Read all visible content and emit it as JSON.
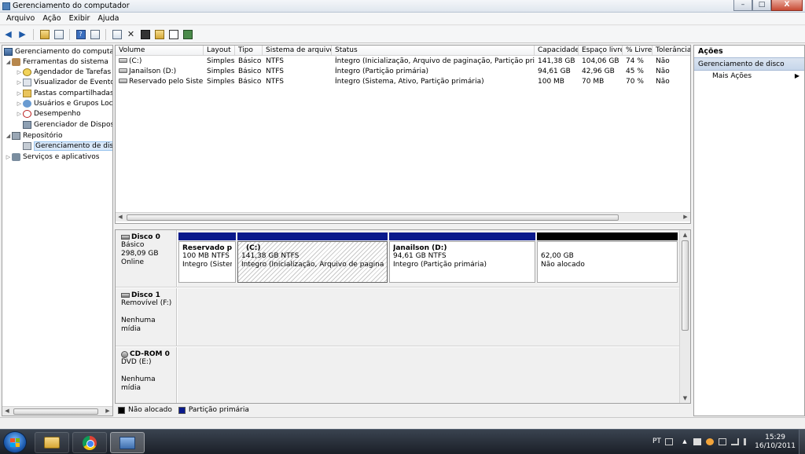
{
  "window": {
    "title": "Gerenciamento do computador",
    "buttons": {
      "minimize": "–",
      "maximize": "□",
      "close": "X"
    }
  },
  "menu": {
    "items": [
      "Arquivo",
      "Ação",
      "Exibir",
      "Ajuda"
    ]
  },
  "toolbar": {
    "icons": [
      "back-arrow-icon",
      "forward-arrow-icon",
      "up-folder-icon",
      "show-tree-icon",
      "help-icon",
      "properties-icon",
      "refresh-icon",
      "delete-icon",
      "properties-sheet-icon",
      "open-icon",
      "search-icon",
      "settings-icon"
    ]
  },
  "tree": {
    "items": [
      {
        "label": "Gerenciamento do computador",
        "icon": "computer-icon"
      },
      {
        "label": "Ferramentas do sistema",
        "icon": "tools-icon"
      },
      {
        "label": "Agendador de Tarefas",
        "icon": "clock-icon"
      },
      {
        "label": "Visualizador de Eventos",
        "icon": "event-log-icon"
      },
      {
        "label": "Pastas compartilhadas",
        "icon": "folder-icon"
      },
      {
        "label": "Usuários e Grupos Loca",
        "icon": "users-icon"
      },
      {
        "label": "Desempenho",
        "icon": "performance-icon"
      },
      {
        "label": "Gerenciador de Disposit",
        "icon": "device-icon"
      },
      {
        "label": "Repositório",
        "icon": "storage-icon"
      },
      {
        "label": "Gerenciamento de disco",
        "icon": "disk-icon"
      },
      {
        "label": "Serviços e aplicativos",
        "icon": "services-icon"
      }
    ]
  },
  "volumes": {
    "columns": [
      "Volume",
      "Layout",
      "Tipo",
      "Sistema de arquivos",
      "Status",
      "Capacidade",
      "Espaço livre",
      "% Livre",
      "Tolerância"
    ],
    "rows": [
      [
        "(C:)",
        "Simples",
        "Básico",
        "NTFS",
        "Íntegro (Inicialização, Arquivo de paginação, Partição primária)",
        "141,38 GB",
        "104,06 GB",
        "74 %",
        "Não"
      ],
      [
        "Janailson (D:)",
        "Simples",
        "Básico",
        "NTFS",
        "Íntegro (Partição primária)",
        "94,61 GB",
        "42,96 GB",
        "45 %",
        "Não"
      ],
      [
        "Reservado pelo Sistema",
        "Simples",
        "Básico",
        "NTFS",
        "Íntegro (Sistema, Ativo, Partição primária)",
        "100 MB",
        "70 MB",
        "70 %",
        "Não"
      ]
    ]
  },
  "disks": [
    {
      "name": "Disco 0",
      "lines": [
        "Básico",
        "298,09 GB",
        "Online"
      ],
      "partitions": [
        {
          "label": "Reservado pelo",
          "size": "100 MB NTFS",
          "status": "Íntegro (Sistema",
          "style": "primary"
        },
        {
          "label": "(C:)",
          "size": "141,38 GB NTFS",
          "status": "Íntegro (Inicialização, Arquivo de paginação, P",
          "style": "primary-selected"
        },
        {
          "label": "Janailson  (D:)",
          "size": "94,61 GB NTFS",
          "status": "Íntegro (Partição primária)",
          "style": "primary"
        },
        {
          "label": "",
          "size": "62,00 GB",
          "status": "Não alocado",
          "style": "unallocated"
        }
      ]
    },
    {
      "name": "Disco 1",
      "lines": [
        "Removível (F:)",
        "",
        "Nenhuma mídia"
      ]
    },
    {
      "name": "CD-ROM 0",
      "lines": [
        "DVD (E:)",
        "",
        "Nenhuma mídia"
      ]
    }
  ],
  "legend": [
    {
      "label": "Não alocado",
      "color": "#000000"
    },
    {
      "label": "Partição primária",
      "color": "#0a1a8c"
    }
  ],
  "actions": {
    "title": "Ações",
    "section": "Gerenciamento de disco",
    "more": "Mais Ações"
  },
  "taskbar": {
    "apps": [
      "windows-explorer-icon",
      "chrome-icon",
      "computer-management-icon"
    ],
    "language": "PT",
    "time": "15:29",
    "date": "16/10/2011"
  },
  "colors": {
    "primary_partition": "#0a1a8c",
    "unallocated": "#000000",
    "selection": "#d9e8f9"
  }
}
